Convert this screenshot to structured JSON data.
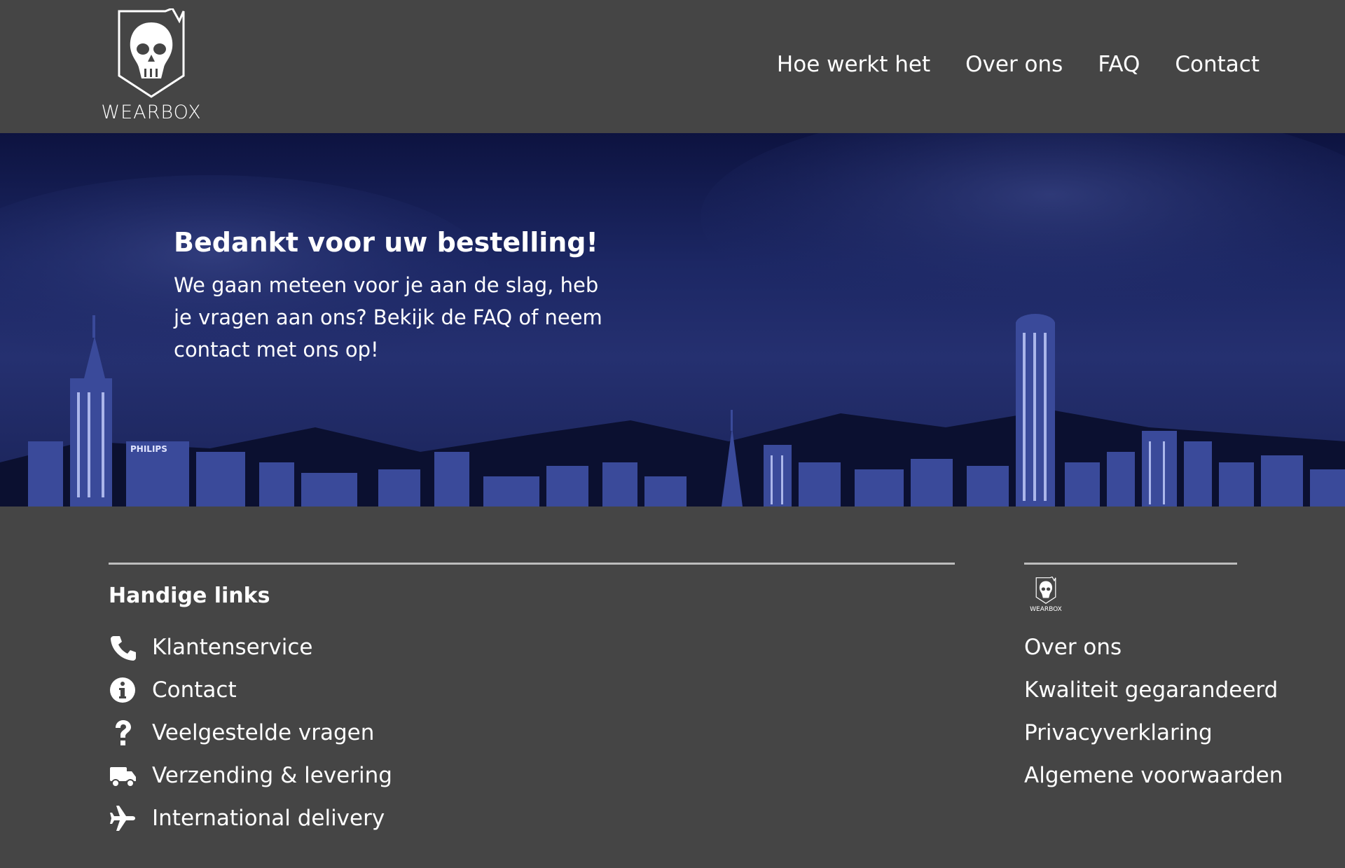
{
  "header": {
    "brand": "WEARBOX",
    "nav": [
      {
        "label": "Hoe werkt het"
      },
      {
        "label": "Over ons"
      },
      {
        "label": "FAQ"
      },
      {
        "label": "Contact"
      }
    ]
  },
  "hero": {
    "title": "Bedankt voor uw bestelling!",
    "body": "We gaan meteen voor je aan de slag, heb je vragen aan ons? Bekijk de FAQ of neem contact met ons op!",
    "sign_text": "PHILIPS"
  },
  "footer": {
    "links_heading": "Handige links",
    "links": [
      {
        "label": "Klantenservice",
        "icon": "phone-icon"
      },
      {
        "label": "Contact",
        "icon": "info-icon"
      },
      {
        "label": "Veelgestelde vragen",
        "icon": "question-icon"
      },
      {
        "label": "Verzending & levering",
        "icon": "truck-icon"
      },
      {
        "label": "International delivery",
        "icon": "plane-icon"
      }
    ],
    "mini_brand": "WEARBOX",
    "right_links": [
      {
        "label": "Over ons"
      },
      {
        "label": "Kwaliteit gegarandeerd"
      },
      {
        "label": "Privacyverklaring"
      },
      {
        "label": "Algemene voorwaarden"
      }
    ]
  },
  "colors": {
    "background": "#454545",
    "text": "#ffffff",
    "rule": "#bdbdbd"
  }
}
